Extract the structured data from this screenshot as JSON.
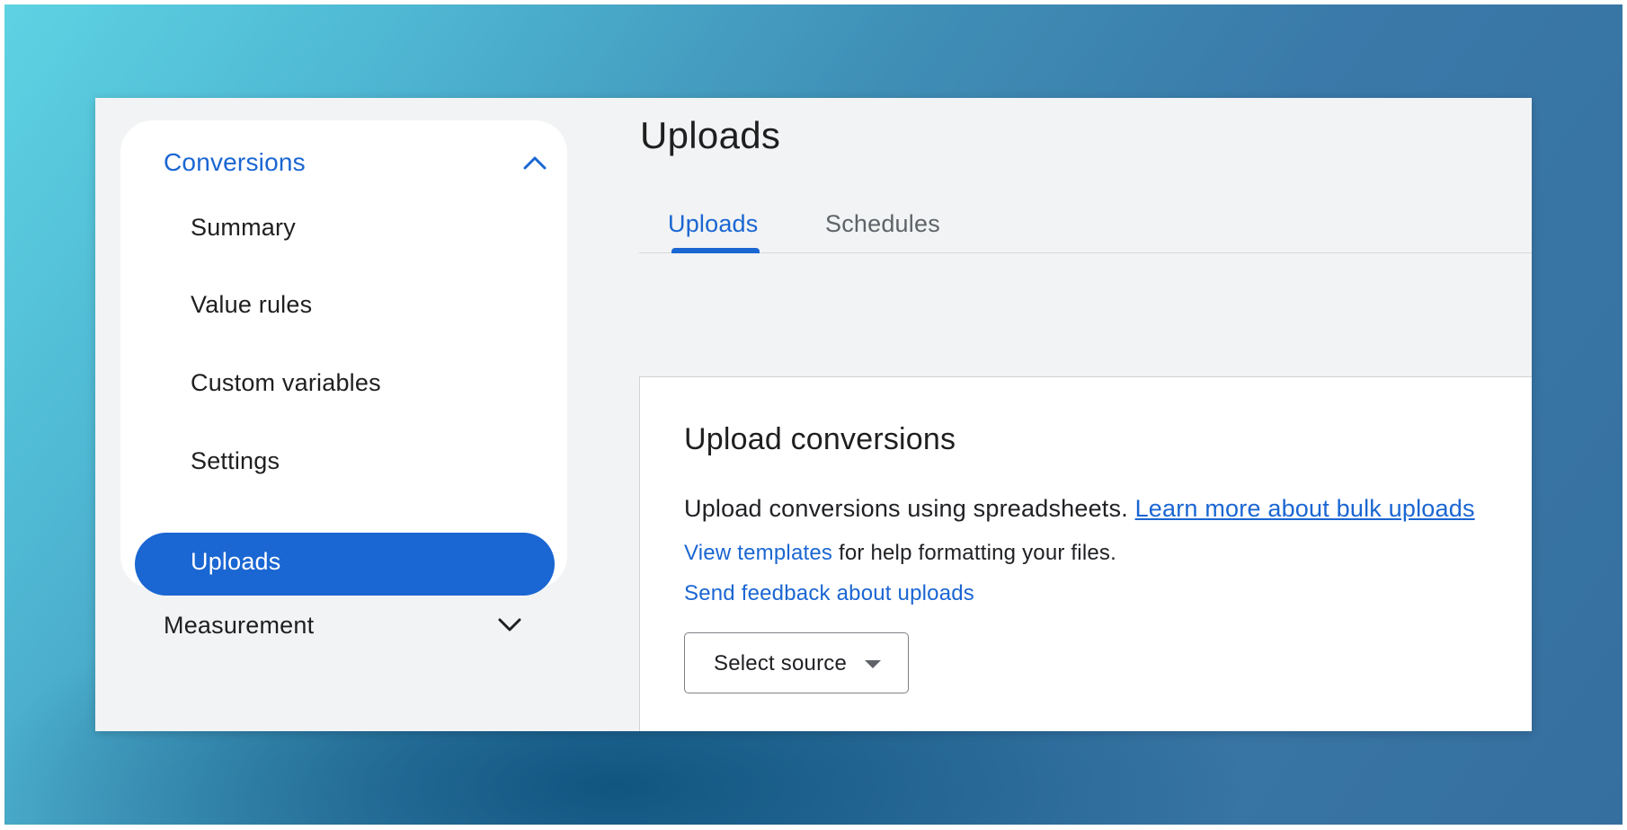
{
  "sidebar": {
    "section_label": "Conversions",
    "items": [
      {
        "label": "Summary"
      },
      {
        "label": "Value rules"
      },
      {
        "label": "Custom variables"
      },
      {
        "label": "Settings"
      },
      {
        "label": "Uploads"
      }
    ],
    "active_item": "Uploads",
    "collapsed_section_label": "Measurement",
    "section_icon": "chevron-up-icon",
    "collapsed_icon": "chevron-down-icon"
  },
  "main": {
    "page_title": "Uploads",
    "tabs": [
      {
        "label": "Uploads",
        "active": true
      },
      {
        "label": "Schedules",
        "active": false
      }
    ],
    "card": {
      "title": "Upload conversions",
      "description": "Upload conversions using spreadsheets.",
      "learn_more_link": "Learn more about bulk uploads",
      "templates_link": "View templates",
      "templates_suffix": " for help formatting your files.",
      "feedback_link": "Send feedback about uploads",
      "select_source_label": "Select source",
      "select_icon": "caret-down-icon"
    }
  },
  "colors": {
    "accent": "#1a66d2",
    "surface": "#f1f3f4",
    "text": "#1f1f1f"
  }
}
